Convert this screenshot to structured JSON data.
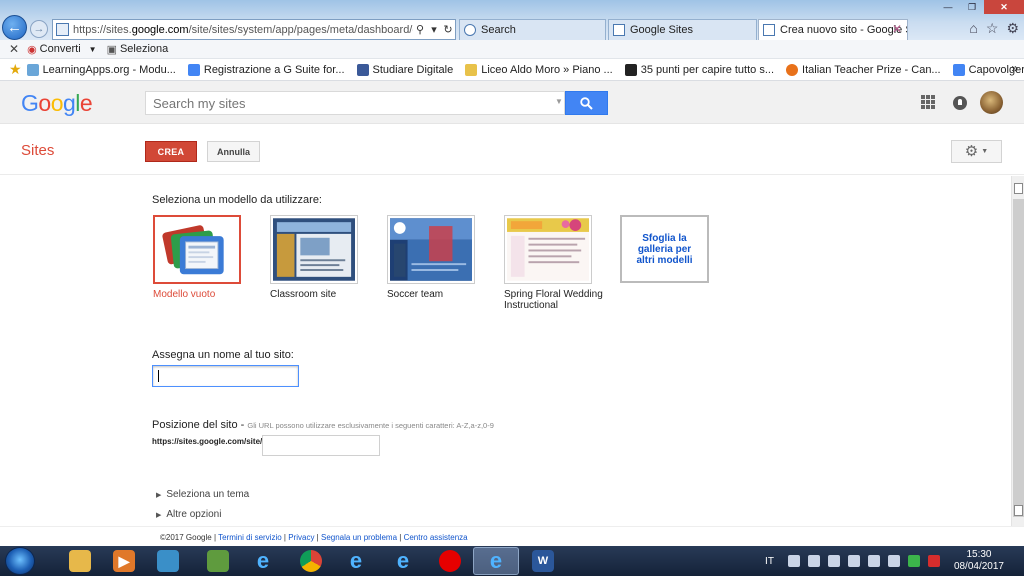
{
  "browser": {
    "url_prefix": "https://sites.",
    "url_domain": "google.com",
    "url_path": "/site/sites/system/app/pages/meta/dashboard/create-new-si",
    "tabs": [
      {
        "label": "Search"
      },
      {
        "label": "Google Sites"
      },
      {
        "label": "Crea nuovo sito - Google Si..."
      }
    ],
    "commands": [
      {
        "label": "Converti",
        "icon": "convert-icon"
      },
      {
        "label": "Seleziona",
        "icon": "select-icon"
      }
    ],
    "favorites": [
      {
        "label": "LearningApps.org - Modu...",
        "color": "#6aa6d8"
      },
      {
        "label": "Registrazione a G Suite for...",
        "color": "#4285f4"
      },
      {
        "label": "Studiare Digitale",
        "color": "#3b5998"
      },
      {
        "label": "Liceo Aldo Moro » Piano ...",
        "color": "#e8c24a"
      },
      {
        "label": "35 punti per capire tutto s...",
        "color": "#222222"
      },
      {
        "label": "Italian Teacher Prize - Can...",
        "color": "#e8711a"
      },
      {
        "label": "Capovolgere la matemati...",
        "color": "#4285f4"
      }
    ]
  },
  "google": {
    "logo": [
      "G",
      "o",
      "o",
      "g",
      "l",
      "e"
    ],
    "logo_colors": [
      "#4285f4",
      "#ea4335",
      "#fbbc05",
      "#4285f4",
      "#34a853",
      "#ea4335"
    ],
    "search_placeholder": "Search my sites"
  },
  "sites": {
    "title": "Sites",
    "create_label": "CREA",
    "cancel_label": "Annulla"
  },
  "content": {
    "choose_template": "Seleziona un modello da utilizzare:",
    "templates": [
      {
        "name": "Modello vuoto",
        "selected": true
      },
      {
        "name": "Classroom site",
        "selected": false
      },
      {
        "name": "Soccer team",
        "selected": false
      },
      {
        "name": "Spring Floral Wedding Instructional",
        "selected": false
      }
    ],
    "browse_gallery": "Sfoglia la galleria per altri modelli",
    "name_label": "Assegna un nome al tuo sito:",
    "name_value": "",
    "location_label": "Posizione del sito -",
    "location_hint": "Gli URL possono utilizzare esclusivamente i seguenti caratteri: A-Z,a-z,0-9",
    "url_prefix": "https://sites.google.com/site/",
    "url_value": "",
    "theme_label": "Seleziona un tema",
    "more_options_label": "Altre opzioni"
  },
  "footer": {
    "copyright": "©2017 Google",
    "links": [
      "Termini di servizio",
      "Privacy",
      "Segnala un problema",
      "Centro assistenza"
    ]
  },
  "taskbar": {
    "lang": "IT",
    "time": "15:30",
    "date": "08/04/2017"
  }
}
